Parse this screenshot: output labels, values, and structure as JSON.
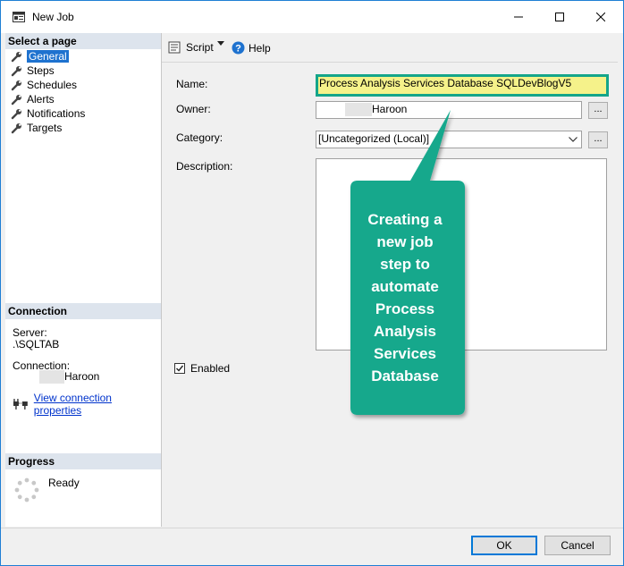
{
  "window": {
    "title": "New Job"
  },
  "left_panel": {
    "select_page_header": "Select a page",
    "pages": [
      {
        "label": "General",
        "selected": true
      },
      {
        "label": "Steps",
        "selected": false
      },
      {
        "label": "Schedules",
        "selected": false
      },
      {
        "label": "Alerts",
        "selected": false
      },
      {
        "label": "Notifications",
        "selected": false
      },
      {
        "label": "Targets",
        "selected": false
      }
    ],
    "connection_header": "Connection",
    "server_label": "Server:",
    "server_value": ".\\SQLTAB",
    "connection_label": "Connection:",
    "connection_value": "Haroon",
    "view_connection_link": "View connection properties",
    "progress_header": "Progress",
    "progress_status": "Ready"
  },
  "toolbar": {
    "script_label": "Script",
    "help_label": "Help"
  },
  "form": {
    "name_label": "Name:",
    "name_value": "Process Analysis Services Database SQLDevBlogV5",
    "owner_label": "Owner:",
    "owner_value": "Haroon",
    "owner_browse": "...",
    "category_label": "Category:",
    "category_value": "[Uncategorized (Local)]",
    "category_browse": "...",
    "description_label": "Description:",
    "description_value": "",
    "enabled_label": "Enabled",
    "enabled_checked": true
  },
  "callout": {
    "lines": [
      "Creating a",
      "new job",
      "step to",
      "automate",
      "Process",
      "Analysis",
      "Services",
      "Database"
    ],
    "color": "#12a88c"
  },
  "buttons": {
    "ok_label": "OK",
    "cancel_label": "Cancel"
  },
  "colors": {
    "accent": "#1e72cf",
    "highlight": "#f5f28a",
    "callout": "#12a88c"
  }
}
